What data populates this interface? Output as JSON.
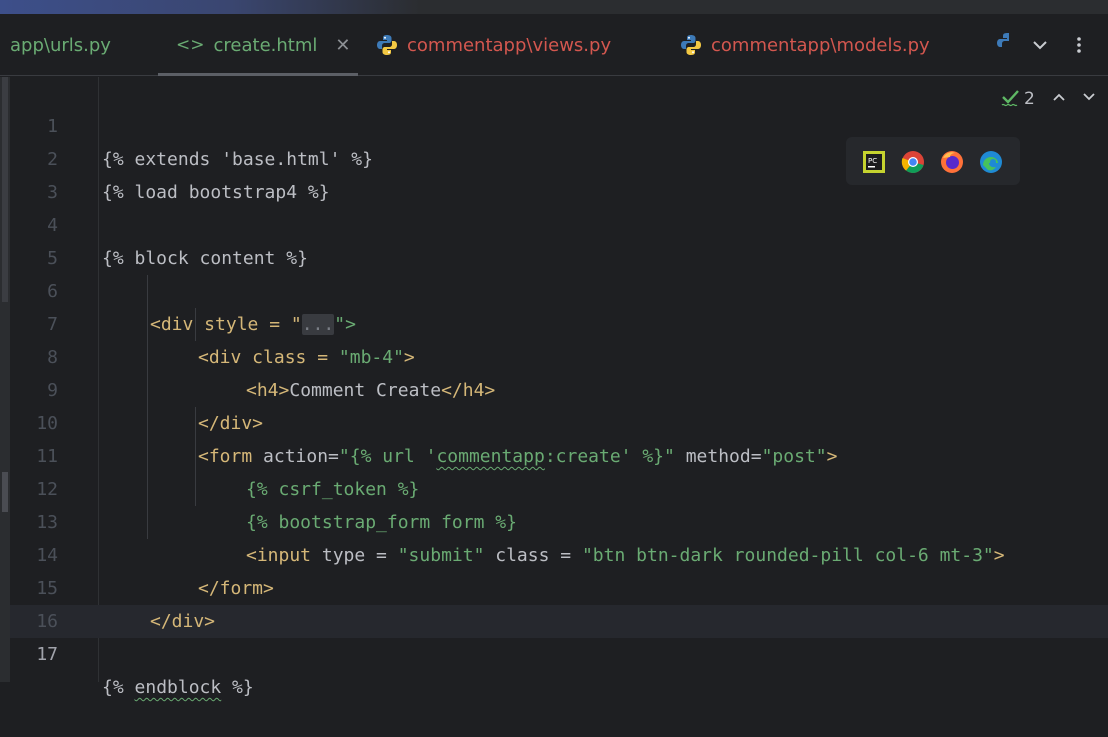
{
  "tabs": [
    {
      "label": "app\\urls.py",
      "type": "python"
    },
    {
      "label": "create.html",
      "type": "html",
      "active": true
    },
    {
      "label": "commentapp\\views.py",
      "type": "python"
    },
    {
      "label": "commentapp\\models.py",
      "type": "python"
    }
  ],
  "tab_controls": {
    "more_tabs": "chevron-down-icon",
    "options": "vertical-dots-icon"
  },
  "inspection": {
    "count": "2"
  },
  "browsers": [
    "PyCharm",
    "Chrome",
    "Firefox",
    "Edge"
  ],
  "editor": {
    "current_line": "17",
    "line_numbers": [
      "1",
      "2",
      "3",
      "4",
      "5",
      "6",
      "7",
      "8",
      "9",
      "10",
      "11",
      "12",
      "13",
      "14",
      "15",
      "16",
      "17"
    ],
    "lines": {
      "l1": "{% extends 'base.html' %}",
      "l2": "{% load bootstrap4 %}",
      "l4": "{% block content %}",
      "l6": {
        "p1": "<div style = \"",
        "fold": "...",
        "p2": "\">"
      },
      "l7": {
        "p1": "<div class = ",
        "p2": "\"mb-4\"",
        "p3": ">"
      },
      "l8": {
        "p1": "<h4>",
        "p2": "Comment Create",
        "p3": "</h4>"
      },
      "l9": "</div>",
      "l10": {
        "p1": "<form ",
        "p2": "action=",
        "p3": "\"{% url '",
        "p4": "commentapp",
        "p5": ":create' %}\"",
        "p6": " method=",
        "p7": "\"post\"",
        "p8": ">"
      },
      "l11": "{% csrf_token %}",
      "l12": "{% bootstrap_form form %}",
      "l13": {
        "p1": "<input ",
        "p2": "type = ",
        "p3": "\"submit\"",
        "p4": " class = ",
        "p5": "\"btn btn-dark rounded-pill col-6 mt-3\"",
        "p6": ">"
      },
      "l14": "</form>",
      "l15": "</div>",
      "l17": {
        "p1": "{% ",
        "p2": "endblock",
        "p3": " %}"
      }
    }
  }
}
